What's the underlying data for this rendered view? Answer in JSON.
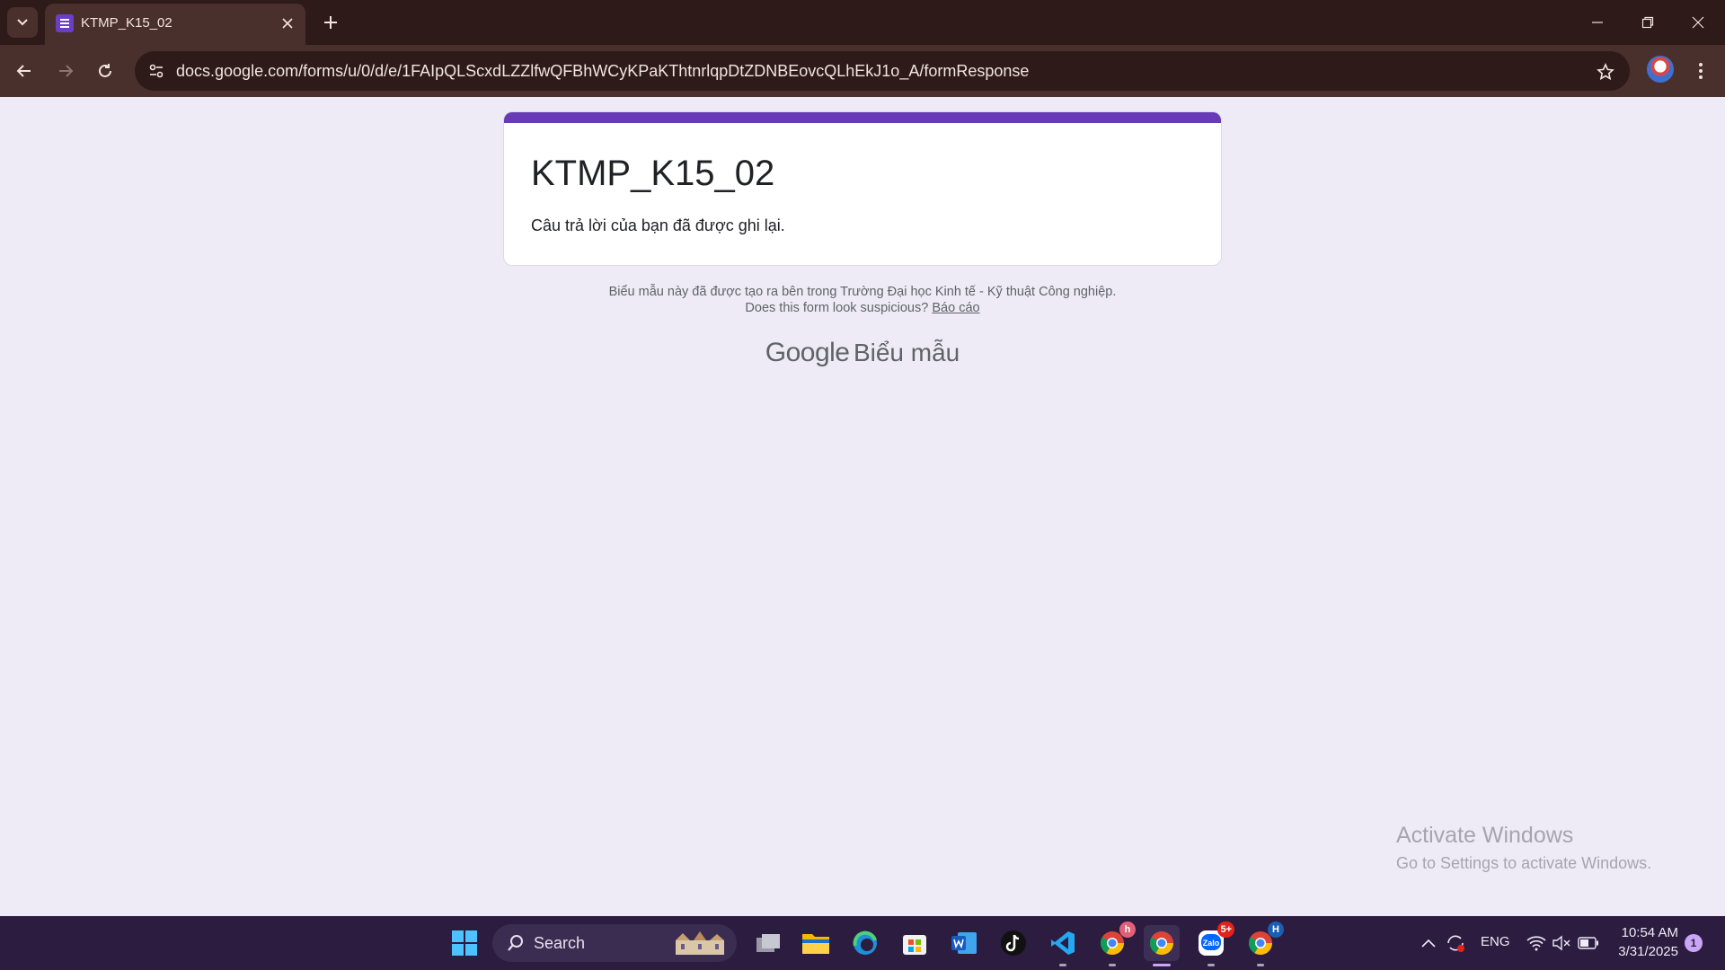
{
  "browser": {
    "tab_title": "KTMP_K15_02",
    "url": "docs.google.com/forms/u/0/d/e/1FAIpQLScxdLZZlfwQFBhWCyKPaKThtnrlqpDtZDNBEovcQLhEkJ1o_A/formResponse"
  },
  "form": {
    "title": "KTMP_K15_02",
    "confirmation": "Câu trả lời của bạn đã được ghi lại.",
    "accent_color": "#673ab7"
  },
  "footer": {
    "created_in": "Biểu mẫu này đã được tạo ra bên trong Trường Đại học Kinh tế - Kỹ thuật Công nghiệp.",
    "suspicious": "Does this form look suspicious?",
    "report_label": "Báo cáo",
    "brand_google": "Google",
    "brand_product": "Biểu mẫu"
  },
  "watermark": {
    "title": "Activate Windows",
    "subtitle": "Go to Settings to activate Windows."
  },
  "taskbar": {
    "search_label": "Search",
    "apps": [
      {
        "name": "task-view",
        "icon": "task-view-icon"
      },
      {
        "name": "file-explorer",
        "icon": "folder-icon"
      },
      {
        "name": "edge",
        "icon": "edge-icon"
      },
      {
        "name": "microsoft-store",
        "icon": "store-icon"
      },
      {
        "name": "word",
        "icon": "word-icon"
      },
      {
        "name": "tiktok",
        "icon": "tiktok-icon"
      },
      {
        "name": "vscode",
        "icon": "vscode-icon"
      },
      {
        "name": "chrome-profile-h",
        "icon": "chrome-icon",
        "badge": "h"
      },
      {
        "name": "chrome-active",
        "icon": "chrome-icon"
      },
      {
        "name": "zalo",
        "icon": "zalo-icon",
        "badge": "5+"
      },
      {
        "name": "chrome-profile-H",
        "icon": "chrome-icon",
        "badge": "H"
      }
    ],
    "language": "ENG",
    "time": "10:54 AM",
    "date": "3/31/2025",
    "notification_count": "1"
  }
}
